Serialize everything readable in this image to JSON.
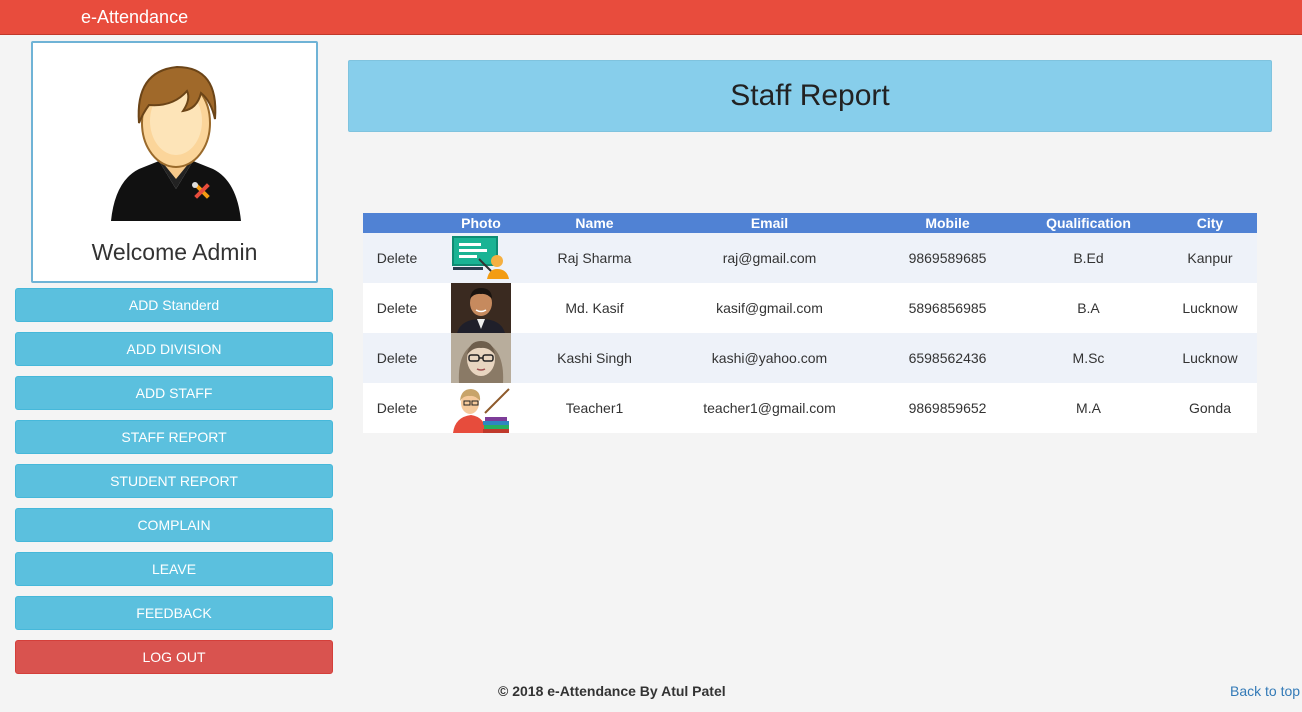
{
  "app": {
    "title": "e-Attendance"
  },
  "profile": {
    "welcome": "Welcome Admin",
    "avatar_icon": "admin-avatar-icon"
  },
  "menu": [
    {
      "label": "ADD Standerd",
      "name": "add-standard-button"
    },
    {
      "label": "ADD DIVISION",
      "name": "add-division-button"
    },
    {
      "label": "ADD STAFF",
      "name": "add-staff-button"
    },
    {
      "label": "STAFF REPORT",
      "name": "staff-report-button"
    },
    {
      "label": "STUDENT REPORT",
      "name": "student-report-button"
    },
    {
      "label": "COMPLAIN",
      "name": "complain-button"
    },
    {
      "label": "LEAVE",
      "name": "leave-button"
    },
    {
      "label": "FEEDBACK",
      "name": "feedback-button"
    },
    {
      "label": "LOG OUT",
      "name": "logout-button"
    }
  ],
  "page": {
    "title": "Staff Report"
  },
  "table": {
    "headers": [
      "",
      "Photo",
      "Name",
      "Email",
      "Mobile",
      "Qualification",
      "City"
    ],
    "rows": [
      {
        "action": "Delete",
        "photo": "teacher-board-photo",
        "name": "Raj Sharma",
        "email": "raj@gmail.com",
        "mobile": "9869589685",
        "qualification": "B.Ed",
        "city": "Kanpur"
      },
      {
        "action": "Delete",
        "photo": "man-portrait-photo",
        "name": "Md. Kasif",
        "email": "kasif@gmail.com",
        "mobile": "5896856985",
        "qualification": "B.A",
        "city": "Lucknow"
      },
      {
        "action": "Delete",
        "photo": "woman-glasses-photo",
        "name": "Kashi Singh",
        "email": "kashi@yahoo.com",
        "mobile": "6598562436",
        "qualification": "M.Sc",
        "city": "Lucknow"
      },
      {
        "action": "Delete",
        "photo": "teacher-books-photo",
        "name": "Teacher1",
        "email": "teacher1@gmail.com",
        "mobile": "9869859652",
        "qualification": "M.A",
        "city": "Gonda"
      }
    ]
  },
  "footer": {
    "copyright": "© 2018 e-Attendance By Atul Patel",
    "back_to_top": "Back to top"
  }
}
